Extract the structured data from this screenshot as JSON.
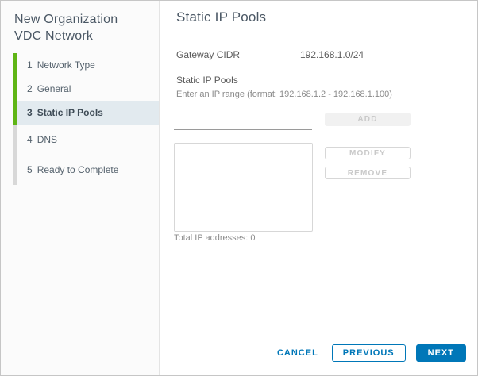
{
  "dialog": {
    "title": "New Organization VDC Network"
  },
  "sidebar": {
    "steps": [
      {
        "number": "1",
        "label": "Network Type",
        "state": "completed"
      },
      {
        "number": "2",
        "label": "General",
        "state": "completed"
      },
      {
        "number": "3",
        "label": "Static IP Pools",
        "state": "active"
      },
      {
        "number": "4",
        "label": "DNS",
        "state": "upcoming"
      },
      {
        "number": "5",
        "label": "Ready to Complete",
        "state": "upcoming"
      }
    ]
  },
  "main": {
    "title": "Static IP Pools",
    "gateway_cidr": {
      "label": "Gateway CIDR",
      "value": "192.168.1.0/24"
    },
    "static_ip_pools": {
      "section_label": "Static IP Pools",
      "hint": "Enter an IP range (format: 192.168.1.2 - 192.168.1.100)",
      "input_value": "",
      "input_placeholder": "",
      "add_label": "ADD",
      "modify_label": "MODIFY",
      "remove_label": "REMOVE",
      "pool_items": [],
      "total_text": "Total IP addresses: 0"
    }
  },
  "footer": {
    "cancel_label": "CANCEL",
    "previous_label": "PREVIOUS",
    "next_label": "NEXT"
  },
  "colors": {
    "accent_blue": "#0077b8",
    "progress_green": "#5fb515",
    "upcoming_gray": "#d8d8d8",
    "active_step_bg": "#e2eaef",
    "disabled_button_bg": "#f1f1f1",
    "disabled_button_text": "#c9c9c9"
  }
}
